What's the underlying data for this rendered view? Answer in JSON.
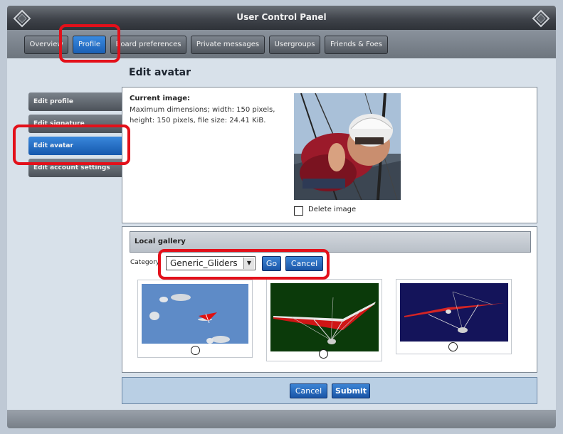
{
  "window": {
    "title": "User Control Panel"
  },
  "tabs": [
    {
      "label": "Overview",
      "active": false
    },
    {
      "label": "Profile",
      "active": true
    },
    {
      "label": "Board preferences",
      "active": false
    },
    {
      "label": "Private messages",
      "active": false
    },
    {
      "label": "Usergroups",
      "active": false
    },
    {
      "label": "Friends & Foes",
      "active": false
    }
  ],
  "sidebar": {
    "items": [
      {
        "label": "Edit profile",
        "active": false
      },
      {
        "label": "Edit signature",
        "active": false
      },
      {
        "label": "Edit avatar",
        "active": true
      },
      {
        "label": "Edit account settings",
        "active": false
      }
    ]
  },
  "page": {
    "title": "Edit avatar"
  },
  "current_image": {
    "heading": "Current image:",
    "line1": "Maximum dimensions; width: 150 pixels,",
    "line2": "height: 150 pixels, file size: 24.41 KiB.",
    "delete_label": "Delete image",
    "delete_checked": false
  },
  "gallery": {
    "heading": "Local gallery",
    "category_label": "Category:",
    "category_value": "Generic_Gliders",
    "go_label": "Go",
    "cancel_label": "Cancel",
    "options": [
      {
        "selected": false
      },
      {
        "selected": false
      },
      {
        "selected": false
      }
    ]
  },
  "footer": {
    "cancel_label": "Cancel",
    "submit_label": "Submit"
  },
  "colors": {
    "accent": "#1a5fb4",
    "highlight": "#e3101a"
  }
}
